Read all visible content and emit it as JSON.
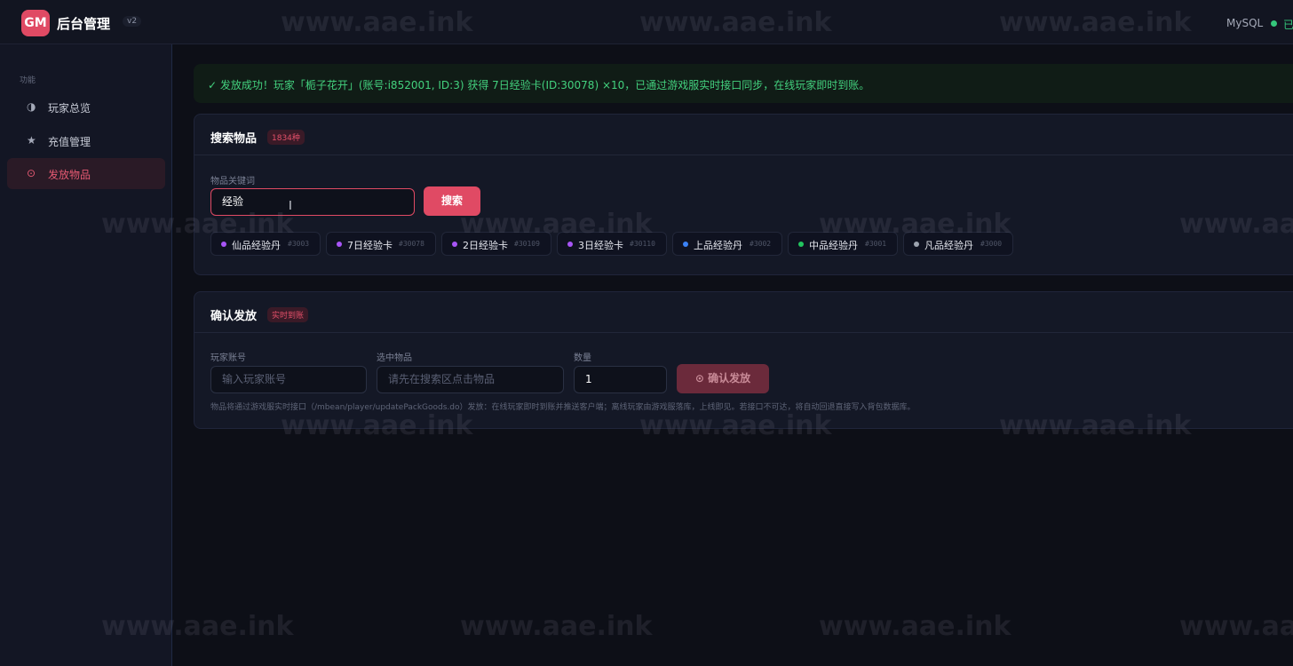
{
  "topbar": {
    "logo_text": "GM",
    "title": "后台管理",
    "version": "v2",
    "db_label": "MySQL",
    "db_status": "已",
    "db_status_color": "#34c77b"
  },
  "sidebar": {
    "section_label": "功能",
    "items": [
      {
        "icon": "◑",
        "icon_name": "half-circle-icon",
        "label": "玩家总览",
        "active": false
      },
      {
        "icon": "★",
        "icon_name": "star-icon",
        "label": "充值管理",
        "active": false
      },
      {
        "icon": "⊙",
        "icon_name": "target-icon",
        "label": "发放物品",
        "active": true
      }
    ]
  },
  "alert": {
    "text": "✓ 发放成功！玩家「栀子花开」(账号:i852001, ID:3) 获得 7日经验卡(ID:30078) ×10，已通过游戏服实时接口同步，在线玩家即时到账。",
    "color": "#43d17e"
  },
  "search_card": {
    "title": "搜索物品",
    "badge": "1834种",
    "keyword_label": "物品关键词",
    "keyword_value": "经验",
    "search_button": "搜索",
    "results": [
      {
        "name": "仙品经验丹",
        "code": "#3003",
        "dot_color": "#a855f7"
      },
      {
        "name": "7日经验卡",
        "code": "#30078",
        "dot_color": "#a855f7"
      },
      {
        "name": "2日经验卡",
        "code": "#30109",
        "dot_color": "#a855f7"
      },
      {
        "name": "3日经验卡",
        "code": "#30110",
        "dot_color": "#a855f7"
      },
      {
        "name": "上品经验丹",
        "code": "#3002",
        "dot_color": "#3b82f6"
      },
      {
        "name": "中品经验丹",
        "code": "#3001",
        "dot_color": "#22c55e"
      },
      {
        "name": "凡品经验丹",
        "code": "#3000",
        "dot_color": "#9ca3af"
      }
    ]
  },
  "confirm_card": {
    "title": "确认发放",
    "badge": "实时到账",
    "account_label": "玩家账号",
    "account_placeholder": "输入玩家账号",
    "item_label": "选中物品",
    "item_placeholder": "请先在搜索区点击物品",
    "qty_label": "数量",
    "qty_value": "1",
    "confirm_button": "⊙ 确认发放",
    "hint": "物品将通过游戏服实时接口（/mbean/player/updatePackGoods.do）发放：在线玩家即时到账并推送客户端；离线玩家由游戏服落库，上线即见。若接口不可达，将自动回退直接写入背包数据库。"
  },
  "watermark": "www.aae.ink"
}
